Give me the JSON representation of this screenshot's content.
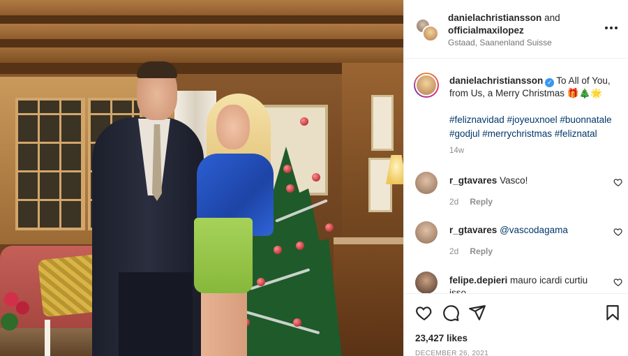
{
  "post": {
    "author": "danielachristiansson",
    "connector": "and",
    "coauthor": "officialmaxilopez",
    "location": "Gstaad, Saanenland Suisse"
  },
  "caption": {
    "username": "danielachristiansson",
    "text": "To All of You, from Us, a Merry Christmas 🎁🎄🌟",
    "hashtags": "#feliznavidad #joyeuxnoel #buonnatale #godjul #merrychristmas #feliznatal",
    "time": "14w"
  },
  "comments": [
    {
      "username": "r_gtavares",
      "text": "Vasco!",
      "time": "2d",
      "reply": "Reply"
    },
    {
      "username": "r_gtavares",
      "text": "@vascodagama",
      "time": "2d",
      "reply": "Reply"
    },
    {
      "username": "felipe.depieri",
      "text": "mauro icardi curtiu isso",
      "time": "",
      "reply": ""
    }
  ],
  "actions": {
    "likes": "23,427 likes",
    "date": "DECEMBER 26, 2021"
  },
  "icons": {
    "more": "more-options-icon",
    "like": "heart-icon",
    "comment": "comment-icon",
    "share": "paper-plane-icon",
    "save": "bookmark-icon",
    "verified": "verified-badge-icon"
  },
  "colors": {
    "hashtag": "#00376b",
    "verified": "#3897f0",
    "muted": "#8e8e8e"
  }
}
